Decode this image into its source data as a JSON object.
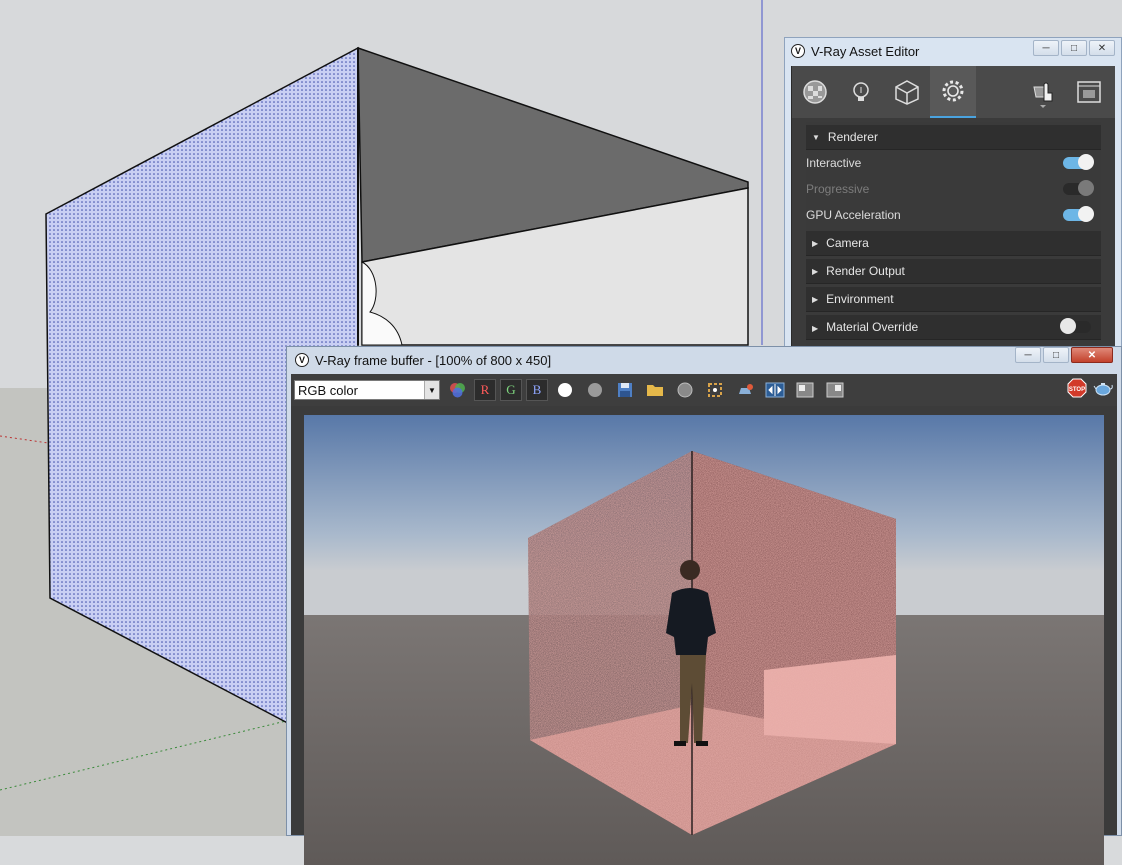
{
  "asset_editor": {
    "title": "V-Ray Asset Editor",
    "logo_glyph": "V",
    "window_buttons": [
      "minimize-icon",
      "maximize-icon",
      "close-icon"
    ],
    "tabs": [
      {
        "name": "materials",
        "icon": "sphere-checker-icon"
      },
      {
        "name": "lights",
        "icon": "lightbulb-icon"
      },
      {
        "name": "geometry",
        "icon": "cube-icon"
      },
      {
        "name": "settings",
        "icon": "gear-icon",
        "active": true
      }
    ],
    "render_button_icon": "teapot-hand-icon",
    "frame_buffer_button_icon": "frame-buffer-icon",
    "renderer": {
      "label": "Renderer",
      "expanded": true,
      "properties": [
        {
          "label": "Interactive",
          "state": "on",
          "enabled": true
        },
        {
          "label": "Progressive",
          "state": "on",
          "enabled": false
        },
        {
          "label": "GPU Acceleration",
          "state": "on",
          "enabled": true
        }
      ]
    },
    "sections": [
      {
        "label": "Camera"
      },
      {
        "label": "Render Output"
      },
      {
        "label": "Environment"
      },
      {
        "label": "Material Override",
        "toggle": "off"
      }
    ],
    "accent_color": "#6db6e6"
  },
  "frame_buffer": {
    "title": "V-Ray frame buffer - [100% of 800 x 450]",
    "logo_glyph": "V",
    "channel": "RGB color",
    "channel_buttons": [
      "R",
      "G",
      "B"
    ],
    "toolbar_icons": [
      "color-correction-icon",
      "white-dot-icon",
      "gray-dot-icon",
      "save-icon",
      "open-folder-icon",
      "clear-icon",
      "region-icon",
      "track-mouse-icon",
      "compare-icon",
      "history-left-icon",
      "history-right-icon"
    ],
    "stop_label": "STOP",
    "render_icon": "teapot-icon"
  }
}
